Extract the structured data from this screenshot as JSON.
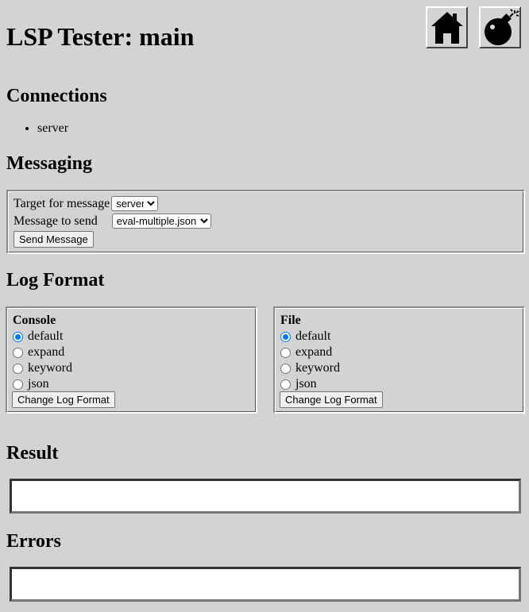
{
  "page": {
    "title": "LSP Tester: main"
  },
  "icons": {
    "home": "home-icon",
    "bomb": "bomb-icon"
  },
  "connections": {
    "heading": "Connections",
    "items": [
      "server"
    ]
  },
  "messaging": {
    "heading": "Messaging",
    "target_label": "Target for message",
    "target_value": "server",
    "message_label": "Message to send",
    "message_value": "eval-multiple.json",
    "send_button": "Send Message"
  },
  "log_format": {
    "heading": "Log Format",
    "console": {
      "legend": "Console",
      "options": [
        "default",
        "expand",
        "keyword",
        "json"
      ],
      "selected": "default",
      "button": "Change Log Format"
    },
    "file": {
      "legend": "File",
      "options": [
        "default",
        "expand",
        "keyword",
        "json"
      ],
      "selected": "default",
      "button": "Change Log Format"
    }
  },
  "result": {
    "heading": "Result",
    "value": ""
  },
  "errors": {
    "heading": "Errors",
    "value": ""
  },
  "colors": {
    "background": "#d3d3d3",
    "radio_accent": "#0075ff"
  }
}
